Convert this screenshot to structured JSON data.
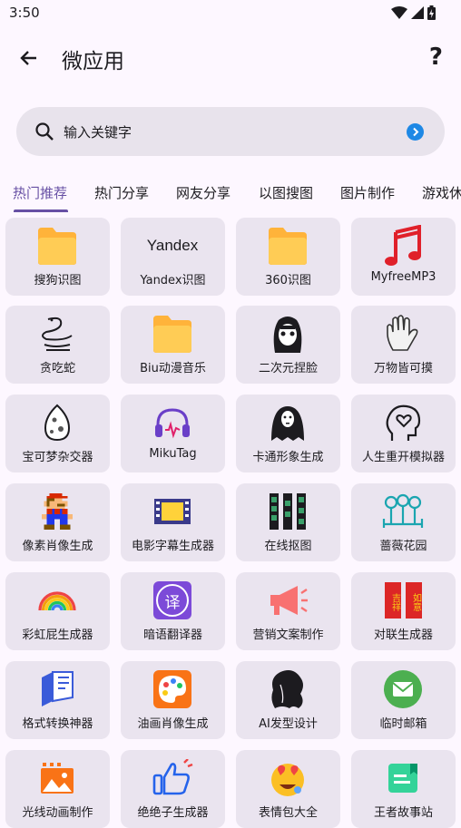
{
  "status": {
    "time": "3:50"
  },
  "appbar": {
    "title": "微应用",
    "help": "?"
  },
  "search": {
    "placeholder": "输入关键字"
  },
  "tabs": [
    {
      "label": "热门推荐",
      "active": true
    },
    {
      "label": "热门分享"
    },
    {
      "label": "网友分享"
    },
    {
      "label": "以图搜图"
    },
    {
      "label": "图片制作"
    },
    {
      "label": "游戏休"
    }
  ],
  "apps": [
    {
      "label": "搜狗识图",
      "icon": "folder-icon"
    },
    {
      "label": "Yandex识图",
      "icon": "yandex-logo",
      "logo_text": "Yandex"
    },
    {
      "label": "360识图",
      "icon": "folder-icon"
    },
    {
      "label": "MyfreeMP3",
      "icon": "music-note-icon"
    },
    {
      "label": "贪吃蛇",
      "icon": "snake-icon"
    },
    {
      "label": "Biu动漫音乐",
      "icon": "folder-icon"
    },
    {
      "label": "二次元捏脸",
      "icon": "anime-face-icon"
    },
    {
      "label": "万物皆可摸",
      "icon": "hand-icon"
    },
    {
      "label": "宝可梦杂交器",
      "icon": "egg-icon"
    },
    {
      "label": "MikuTag",
      "icon": "headphones-icon"
    },
    {
      "label": "卡通形象生成",
      "icon": "ghost-icon"
    },
    {
      "label": "人生重开模拟器",
      "icon": "head-heart-icon"
    },
    {
      "label": "像素肖像生成",
      "icon": "pixel-mario-icon"
    },
    {
      "label": "电影字幕生成器",
      "icon": "film-icon"
    },
    {
      "label": "在线抠图",
      "icon": "filmstrip-icon"
    },
    {
      "label": "蔷薇花园",
      "icon": "garden-icon"
    },
    {
      "label": "彩虹屁生成器",
      "icon": "rainbow-icon"
    },
    {
      "label": "暗语翻译器",
      "icon": "translate-icon",
      "logo_text": "译"
    },
    {
      "label": "营销文案制作",
      "icon": "megaphone-icon"
    },
    {
      "label": "对联生成器",
      "icon": "couplet-icon",
      "logo_text": [
        "吉祥",
        "如意"
      ]
    },
    {
      "label": "格式转换神器",
      "icon": "convert-icon"
    },
    {
      "label": "油画肖像生成",
      "icon": "palette-icon"
    },
    {
      "label": "AI发型设计",
      "icon": "hair-icon"
    },
    {
      "label": "临时邮箱",
      "icon": "mail-icon"
    },
    {
      "label": "光线动画制作",
      "icon": "image-icon"
    },
    {
      "label": "绝绝子生成器",
      "icon": "thumbs-up-icon"
    },
    {
      "label": "表情包大全",
      "icon": "emoji-icon"
    },
    {
      "label": "王者故事站",
      "icon": "book-icon"
    }
  ]
}
